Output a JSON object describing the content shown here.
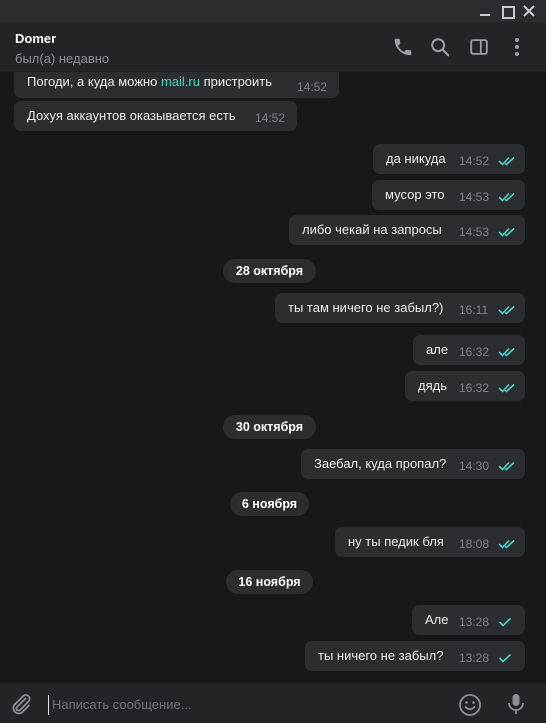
{
  "header": {
    "name": "Domer",
    "status": "был(а) недавно",
    "icons": [
      "phone-icon",
      "search-icon",
      "sidebar-toggle-icon",
      "more-icon"
    ]
  },
  "window": {
    "controls": [
      "minimize",
      "maximize",
      "close"
    ]
  },
  "messages": [
    {
      "kind": "in",
      "text_before": "Погоди, а куда можно ",
      "link": "mail.ru",
      "text_after": " пристроить",
      "time": "14:52"
    },
    {
      "kind": "in",
      "text": "Дохуя аккаунтов оказывается есть",
      "time": "14:52"
    },
    {
      "kind": "out",
      "text": "да никуда",
      "time": "14:52",
      "read": true
    },
    {
      "kind": "out",
      "text": "мусор это",
      "time": "14:53",
      "read": true
    },
    {
      "kind": "out",
      "text": "либо чекай на запросы",
      "time": "14:53",
      "read": true
    },
    {
      "kind": "date",
      "text": "28 октября"
    },
    {
      "kind": "out",
      "text": "ты там ничего не забыл?)",
      "time": "16:11",
      "read": true
    },
    {
      "kind": "out",
      "text": "але",
      "time": "16:32",
      "read": true
    },
    {
      "kind": "out",
      "text": "дядь",
      "time": "16:32",
      "read": true
    },
    {
      "kind": "date",
      "text": "30 октября"
    },
    {
      "kind": "out",
      "text": "Заебал, куда пропал?",
      "time": "14:30",
      "read": true
    },
    {
      "kind": "date",
      "text": "6 ноября"
    },
    {
      "kind": "out",
      "text": "ну ты педик бля",
      "time": "18:08",
      "read": true
    },
    {
      "kind": "date",
      "text": "16 ноября"
    },
    {
      "kind": "out",
      "text": "Але",
      "time": "13:28",
      "read": false
    },
    {
      "kind": "out",
      "text": "ты ничего не забыл?",
      "time": "13:28",
      "read": false
    }
  ],
  "composer": {
    "placeholder": "Написать сообщение..."
  },
  "colors": {
    "background": "#17181c",
    "bubble": "#2b2d31",
    "accent": "#4fd1c5",
    "header": "#232428"
  }
}
